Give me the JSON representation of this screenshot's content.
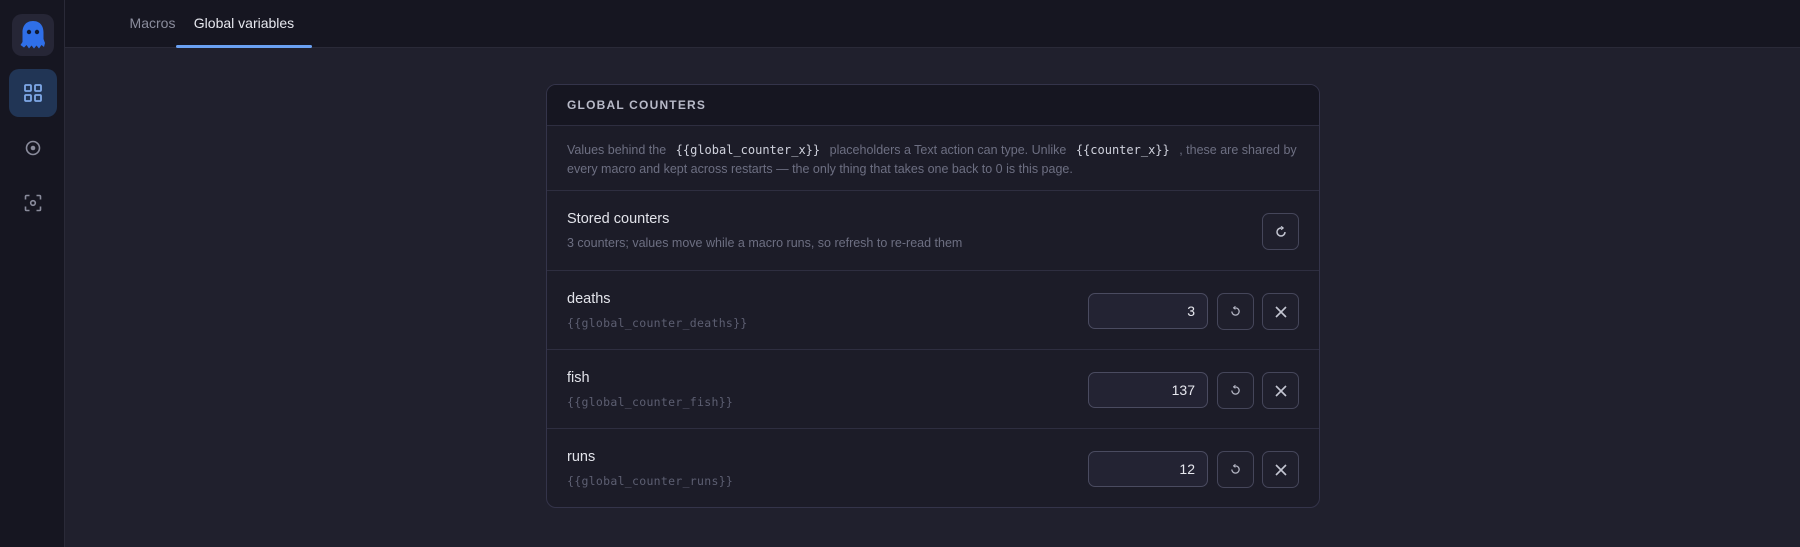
{
  "nav": {
    "logo_icon": "ghost-icon",
    "items": [
      {
        "icon": "grid-icon",
        "active": true
      },
      {
        "icon": "record-icon",
        "active": false
      },
      {
        "icon": "capture-icon",
        "active": false
      }
    ]
  },
  "tabs": [
    {
      "label": "Macros",
      "active": false
    },
    {
      "label": "Global variables",
      "active": true
    }
  ],
  "card": {
    "title": "GLOBAL COUNTERS",
    "description": {
      "part1": "Values behind the",
      "code1": "{{global_counter_x}}",
      "part2": "placeholders a Text action can type. Unlike",
      "code2": "{{counter_x}}",
      "part3": ", these are shared by every macro and kept across restarts — the only thing that takes one back to 0 is this page."
    },
    "stored": {
      "title": "Stored counters",
      "subtitle": "3 counters; values move while a macro runs, so refresh to re-read them",
      "refresh_icon": "refresh-icon"
    },
    "counters": [
      {
        "name": "deaths",
        "placeholder": "{{global_counter_deaths}}",
        "value": "3"
      },
      {
        "name": "fish",
        "placeholder": "{{global_counter_fish}}",
        "value": "137"
      },
      {
        "name": "runs",
        "placeholder": "{{global_counter_runs}}",
        "value": "12"
      }
    ]
  },
  "colors": {
    "accent": "#6aa1f3",
    "logo": "#2f6fe8",
    "background": "#20202d",
    "sidebar": "#161621"
  }
}
